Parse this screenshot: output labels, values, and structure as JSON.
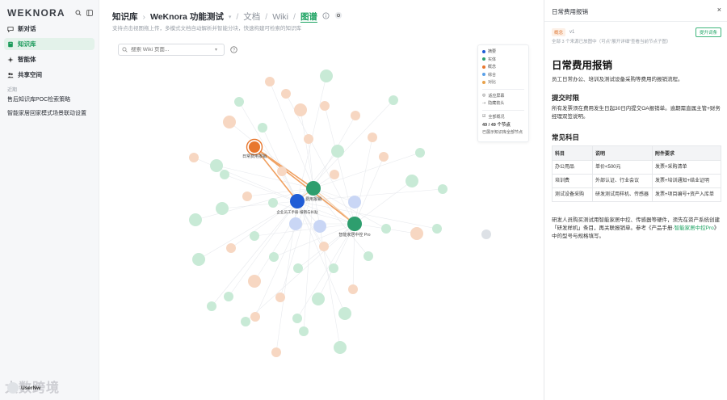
{
  "sidebar": {
    "logo": "WEKNORA",
    "nav": [
      {
        "label": "新对话",
        "icon": "chat-plus-icon"
      },
      {
        "label": "知识库",
        "icon": "book-icon"
      },
      {
        "label": "智能体",
        "icon": "sparkle-icon"
      },
      {
        "label": "共享空间",
        "icon": "people-icon"
      }
    ],
    "section_label": "近期",
    "recent": [
      "售后知识库POC检索策略",
      "智能家居回家模式场景联动设置"
    ],
    "user_name": "UserNw",
    "watermark": "太数跨境"
  },
  "breadcrumb": {
    "root": "知识库",
    "kb": "WeKnora 功能测试",
    "docs": "文档",
    "wiki": "Wiki",
    "graph": "图谱"
  },
  "subtitle": "支持点击视图拖上传，多模式文档自动解析并智能分块，快速构建可检索的知识库",
  "search": {
    "placeholder": "搜索 Wiki 页面..."
  },
  "legend": {
    "types": [
      {
        "label": "摘要",
        "color": "#1f5cd6"
      },
      {
        "label": "实体",
        "color": "#2e9e6e"
      },
      {
        "label": "概念",
        "color": "#e8772e"
      },
      {
        "label": "综合",
        "color": "#5aa0e8"
      },
      {
        "label": "对比",
        "color": "#e8a24a"
      }
    ],
    "options": [
      "适应屏幕",
      "隐藏箭头"
    ],
    "overview_label": "全部概况",
    "node_count": "49 / 49 个节点",
    "note": "已展示知识库全部节点"
  },
  "graph_labels": {
    "selected": "日常费用报销",
    "hub1": "费用报销",
    "hub2": "企业员工手册·报销与补贴",
    "hub3": "智能家居中控 Pro"
  },
  "panel": {
    "title": "日常费用报销",
    "close": "×",
    "badge": "概念",
    "version": "v1",
    "promote": "提升词条",
    "meta_note": "全部 3 个来源已放图中（可点\"展开详细\"查看当前节点子图）",
    "h1": "日常费用报销",
    "intro": "员工日常办公、培训及测试设备采购等费用的报销流程。",
    "h2_time": "提交时限",
    "time_text": "所有发票须在费用发生日起30日内提交OA报销单。逾期需直属主管+财务经理双签说明。",
    "h2_items": "常见科目",
    "table": {
      "headers": [
        "科目",
        "说明",
        "附件要求"
      ],
      "rows": [
        [
          "办公用品",
          "单价<500元",
          "发票+采购清单"
        ],
        [
          "培训费",
          "外部认证、行业会议",
          "发票+培训通知+结业证明"
        ],
        [
          "测试设备采购",
          "研发测试用样机、传感器",
          "发票+项目编号+资产入库单"
        ]
      ]
    },
    "note_text": "研发人员购买测试用智能家居中控、传感器等硬件，须先在资产系统创建「研发样机」条目，再关联报销单。参考《产品手册·",
    "note_link": "智能家居中控Pro",
    "note_tail": "》中的型号与规格填写。"
  }
}
